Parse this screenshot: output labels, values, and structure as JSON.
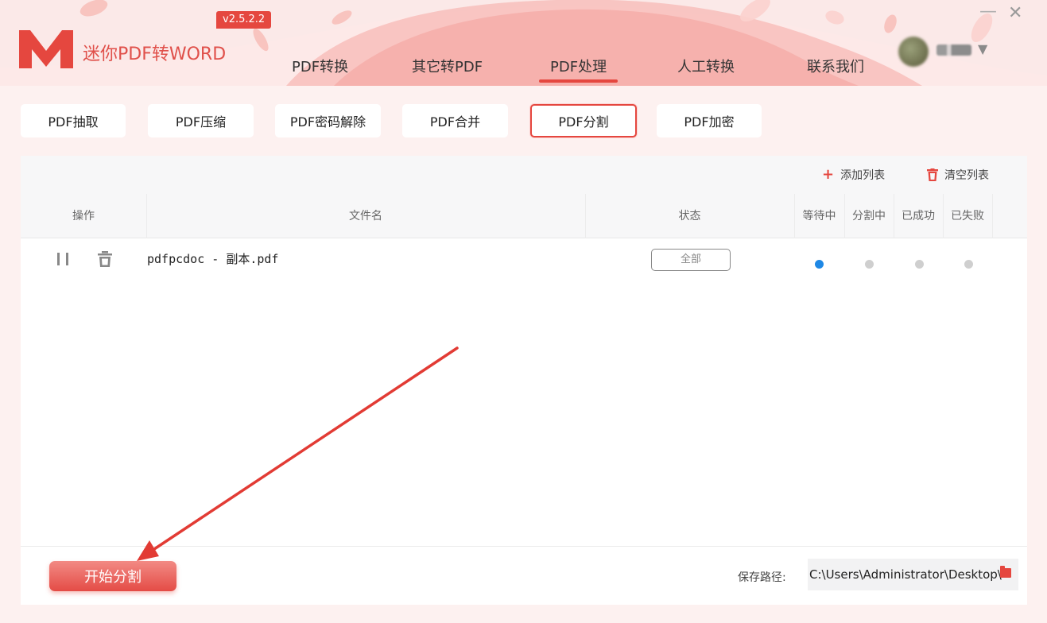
{
  "app": {
    "title": "迷你PDF转WORD",
    "version": "v2.5.2.2"
  },
  "nav": [
    {
      "label": "PDF转换"
    },
    {
      "label": "其它转PDF"
    },
    {
      "label": "PDF处理"
    },
    {
      "label": "人工转换"
    },
    {
      "label": "联系我们"
    }
  ],
  "nav_active": "PDF处理",
  "window": {
    "minimize": "—",
    "close": "✕",
    "user_caret": "▼"
  },
  "tools": [
    {
      "label": "PDF抽取"
    },
    {
      "label": "PDF压缩"
    },
    {
      "label": "PDF密码解除"
    },
    {
      "label": "PDF合并"
    },
    {
      "label": "PDF分割"
    },
    {
      "label": "PDF加密"
    }
  ],
  "tool_active": "PDF分割",
  "toolbar": {
    "add_list": "添加列表",
    "add_icon": "+",
    "clear_list": "清空列表"
  },
  "columns": {
    "action": "操作",
    "filename": "文件名",
    "status": "状态",
    "waiting": "等待中",
    "splitting": "分割中",
    "succeeded": "已成功",
    "failed": "已失败"
  },
  "files": [
    {
      "name": "pdfpcdoc - 副本.pdf",
      "status": "全部",
      "stage": "waiting"
    }
  ],
  "footer": {
    "start_button": "开始分割",
    "save_label": "保存路径:",
    "save_path": "C:\\Users\\Administrator\\Desktop\\"
  },
  "colors": {
    "accent": "#e5473f",
    "active_dot": "#1e88e5",
    "inactive_dot": "#cfcfcf"
  },
  "icons": {
    "add": "plus-icon",
    "clear": "trash-icon",
    "pause": "pause-icon",
    "delete": "trash-icon",
    "folder": "folder-icon",
    "logo": "logo-m-icon"
  }
}
